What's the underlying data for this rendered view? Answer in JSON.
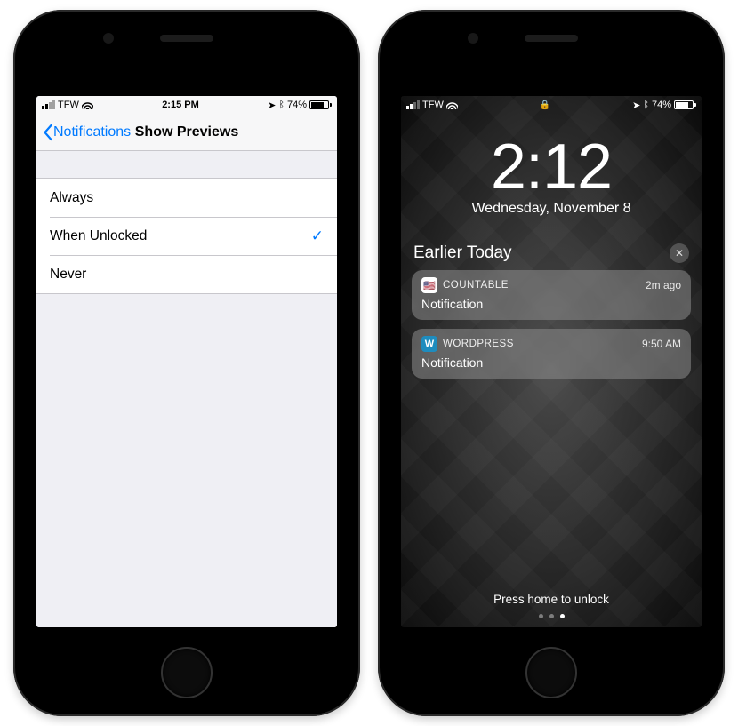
{
  "left": {
    "status": {
      "carrier": "TFW",
      "time": "2:15 PM",
      "battery": "74%"
    },
    "nav": {
      "back_label": "Notifications",
      "title": "Show Previews"
    },
    "options": [
      {
        "label": "Always",
        "selected": false
      },
      {
        "label": "When Unlocked",
        "selected": true
      },
      {
        "label": "Never",
        "selected": false
      }
    ]
  },
  "right": {
    "status": {
      "carrier": "TFW",
      "battery": "74%"
    },
    "clock": {
      "time": "2:12",
      "date": "Wednesday, November 8"
    },
    "section_title": "Earlier Today",
    "notifications": [
      {
        "app": "COUNTABLE",
        "when": "2m ago",
        "body": "Notification",
        "icon": "🇺🇸"
      },
      {
        "app": "WORDPRESS",
        "when": "9:50 AM",
        "body": "Notification",
        "icon": "W"
      }
    ],
    "unlock_hint": "Press home to unlock"
  }
}
